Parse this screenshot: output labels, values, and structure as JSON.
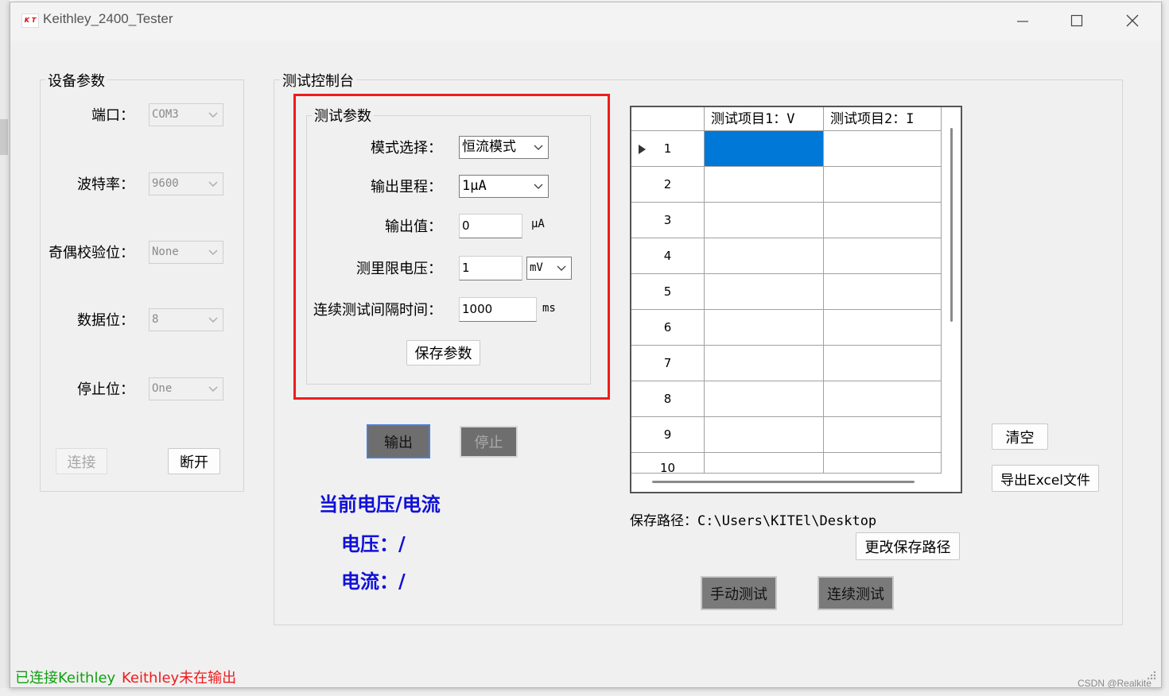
{
  "window": {
    "icon_text": "K T",
    "title": "Keithley_2400_Tester",
    "minimize_glyph": "—",
    "maximize_glyph": "☐",
    "close_glyph": "✕"
  },
  "device_params": {
    "group_title": "设备参数",
    "port": {
      "label": "端口：",
      "value": "COM3"
    },
    "baud": {
      "label": "波特率：",
      "value": "9600"
    },
    "parity": {
      "label": "奇偶校验位：",
      "value": "None"
    },
    "databits": {
      "label": "数据位：",
      "value": "8"
    },
    "stopbits": {
      "label": "停止位：",
      "value": "One"
    },
    "connect_label": "连接",
    "disconnect_label": "断开"
  },
  "console": {
    "group_title": "测试控制台",
    "test_params": {
      "group_title": "测试参数",
      "mode": {
        "label": "模式选择：",
        "value": "恒流模式"
      },
      "range": {
        "label": "输出里程：",
        "value": "1μA"
      },
      "output_value": {
        "label": "输出值：",
        "value": "0",
        "unit": "μA"
      },
      "limit": {
        "label": "测里限电压：",
        "value": "1",
        "unit_value": "mV"
      },
      "interval": {
        "label": "连续测试间隔时间：",
        "value": "1000",
        "unit": "ms"
      },
      "save_label": "保存参数"
    },
    "output_label": "输出",
    "stop_label": "停止",
    "current_title": "当前电压/电流",
    "voltage_line": "电压：/",
    "current_line": "电流：/",
    "grid": {
      "columns": [
        "测试项目1：V",
        "测试项目2：I"
      ],
      "rows": [
        "1",
        "2",
        "3",
        "4",
        "5",
        "6",
        "7",
        "8",
        "9",
        "10"
      ],
      "selected_row": "1"
    },
    "clear_label": "清空",
    "export_label": "导出Excel文件",
    "save_path": "保存路径：C:\\Users\\KITEl\\Desktop",
    "change_path_label": "更改保存路径",
    "manual_test_label": "手动测试",
    "continuous_test_label": "连续测试"
  },
  "status": {
    "connected": "已连接Keithley",
    "output_state": "Keithley未在输出"
  },
  "watermark": "CSDN @Realkite",
  "colors": {
    "selection": "#0078d7",
    "highlight_border": "#ee1c1c",
    "readout_text": "#1010d8",
    "status_ok": "#12a012",
    "status_warn": "#ee1c1c"
  }
}
